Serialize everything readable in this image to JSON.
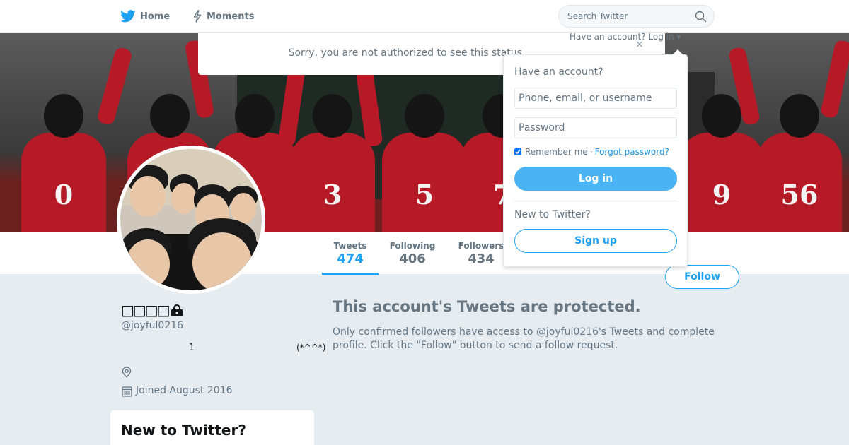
{
  "nav": {
    "home_label": "Home",
    "moments_label": "Moments",
    "search_placeholder": "Search Twitter",
    "have_account_text": "Have an account?",
    "login_link": "Log in",
    "icons": [
      "twitter-bird-icon",
      "lightning-icon",
      "search-icon",
      "chevron-down-icon"
    ]
  },
  "notice": {
    "text": "Sorry, you are not authorized to see this status.",
    "close": "×"
  },
  "banner": {
    "jersey_numbers": [
      "0",
      "3",
      "5",
      "7",
      "9",
      "56"
    ]
  },
  "profile_nav": {
    "tweets_label": "Tweets",
    "tweets_value": "474",
    "following_label": "Following",
    "following_value": "406",
    "followers_label": "Followers",
    "followers_value": "434"
  },
  "follow_button": "Follow",
  "profile": {
    "name": "□□□□",
    "screen_name": "@joyful0216",
    "bio_number": "1",
    "bio_emoticon": "(*^^*)",
    "joined": "Joined August 2016",
    "icons": [
      "lock-icon",
      "location-pin-icon",
      "calendar-icon"
    ]
  },
  "signup_card": {
    "title": "New to Twitter?"
  },
  "protected": {
    "title": "This account's Tweets are protected.",
    "body": "Only confirmed followers have access to @joyful0216's Tweets and complete profile. Click the \"Follow\" button to send a follow request."
  },
  "login_dropdown": {
    "heading": "Have an account?",
    "username_placeholder": "Phone, email, or username",
    "password_placeholder": "Password",
    "remember_label": "Remember me",
    "separator": "·",
    "forgot_label": "Forgot password?",
    "login_button": "Log in",
    "new_label": "New to Twitter?",
    "signup_button": "Sign up"
  },
  "colors": {
    "accent": "#1da1f2",
    "login_button_bg": "#4ab3f4",
    "page_bg": "#e6ecf0",
    "jersey_red": "#b51a26"
  }
}
